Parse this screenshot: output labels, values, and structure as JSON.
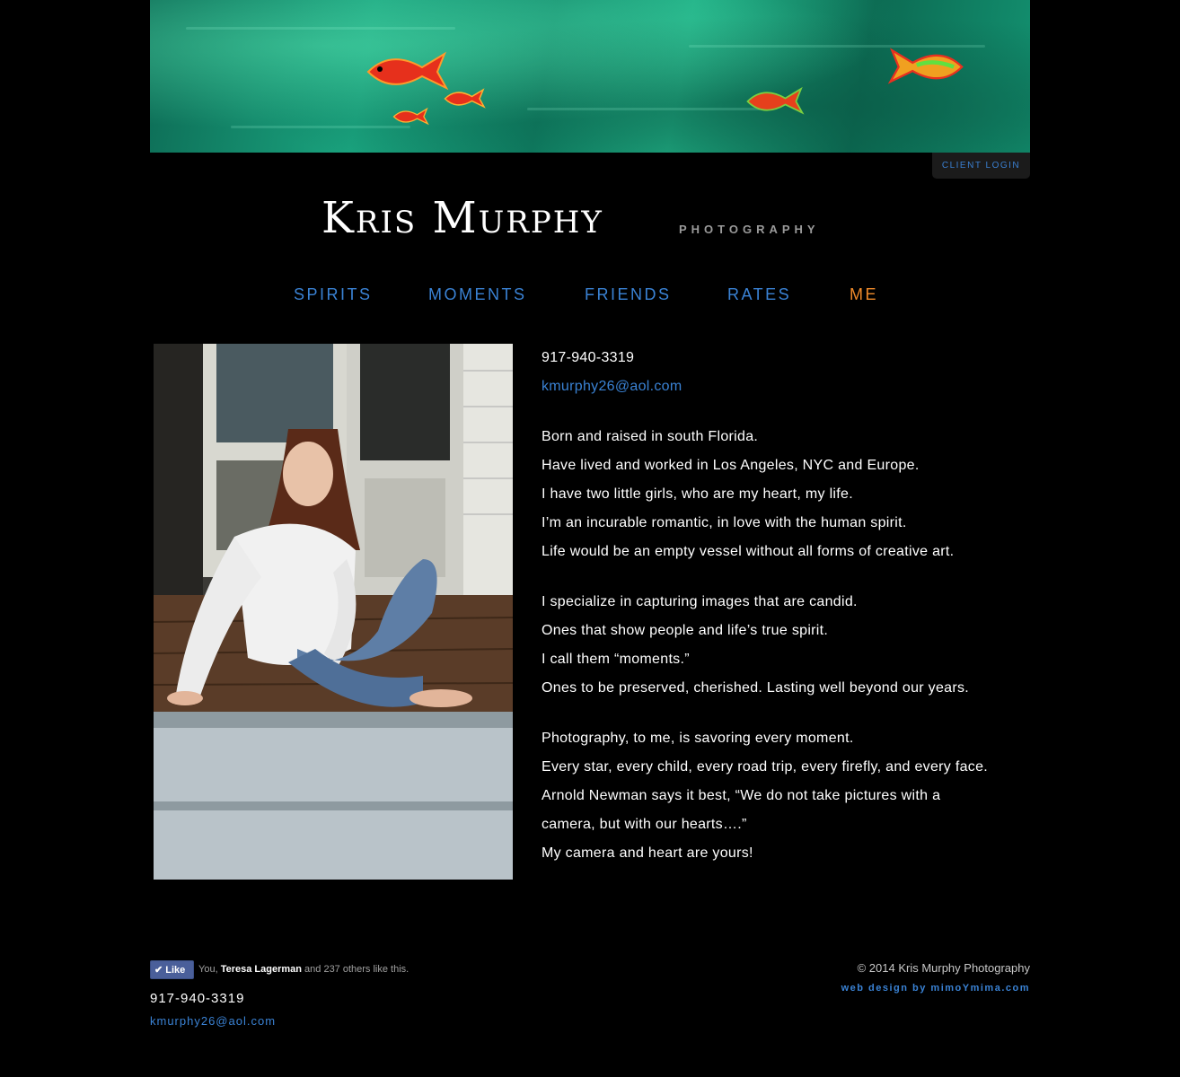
{
  "header": {
    "client_login": "CLIENT LOGIN",
    "logo_name": "Kris Murphy",
    "logo_sub": "PHOTOGRAPHY"
  },
  "nav": {
    "items": [
      {
        "label": "SPIRITS",
        "active": false
      },
      {
        "label": "MOMENTS",
        "active": false
      },
      {
        "label": "FRIENDS",
        "active": false
      },
      {
        "label": "RATES",
        "active": false
      },
      {
        "label": "ME",
        "active": true
      }
    ]
  },
  "contact": {
    "phone": "917-940-3319",
    "email": "kmurphy26@aol.com"
  },
  "bio": {
    "para1": [
      "Born and raised in south Florida.",
      "Have lived and worked in Los Angeles, NYC and Europe.",
      "I have two little girls, who are my heart, my life.",
      "I’m an incurable romantic, in love with the human spirit.",
      "Life would be an empty vessel without all forms of creative art."
    ],
    "para2": [
      "I specialize in capturing images that are candid.",
      "Ones that show people and life’s true spirit.",
      "I call them “moments.”",
      "Ones to be preserved, cherished. Lasting well beyond our years."
    ],
    "para3": [
      "Photography, to me, is savoring every moment.",
      "Every star, every child, every road trip, every firefly, and every face.",
      "Arnold Newman says it best, “We do not take pictures with a",
      "camera, but with our hearts….”",
      "My camera and heart are yours!"
    ]
  },
  "footer": {
    "like_button": "Like",
    "like_prefix": "You, ",
    "like_name": "Teresa Lagerman",
    "like_suffix": " and 237 others like this.",
    "phone": "917-940-3319",
    "email": "kmurphy26@aol.com",
    "copyright": "© 2014 Kris Murphy Photography",
    "web_design": "web design by mimoYmima.com"
  },
  "colors": {
    "background": "#000000",
    "link_blue": "#3a82d4",
    "active_orange": "#f08a2a"
  }
}
